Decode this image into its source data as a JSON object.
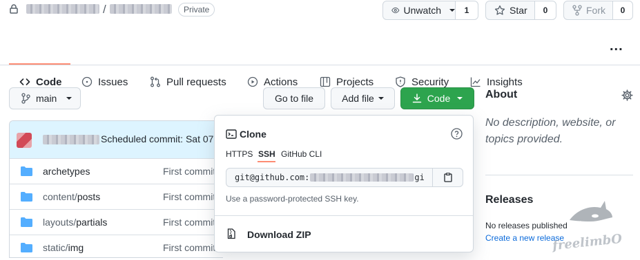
{
  "repo": {
    "visibility": "Private"
  },
  "header": {
    "unwatch_label": "Unwatch",
    "unwatch_count": "1",
    "star_label": "Star",
    "star_count": "0",
    "fork_label": "Fork",
    "fork_count": "0"
  },
  "nav": {
    "tabs": [
      {
        "label": "Code",
        "icon": "code-icon"
      },
      {
        "label": "Issues",
        "icon": "issue-icon"
      },
      {
        "label": "Pull requests",
        "icon": "pull-request-icon"
      },
      {
        "label": "Actions",
        "icon": "play-icon"
      },
      {
        "label": "Projects",
        "icon": "table-icon"
      },
      {
        "label": "Security",
        "icon": "shield-icon"
      },
      {
        "label": "Insights",
        "icon": "graph-icon"
      }
    ],
    "more": "..."
  },
  "toolbar": {
    "branch": "main",
    "go_to_file": "Go to file",
    "add_file": "Add file",
    "code": "Code"
  },
  "commit": {
    "message": "Scheduled commit: Sat 07"
  },
  "files": [
    {
      "dir": "",
      "name": "archetypes",
      "message": "First commit"
    },
    {
      "dir": "content/",
      "name": "posts",
      "message": "First commit"
    },
    {
      "dir": "layouts/",
      "name": "partials",
      "message": "First commit"
    },
    {
      "dir": "static/",
      "name": "img",
      "message": "First commit"
    }
  ],
  "clone": {
    "title": "Clone",
    "tabs": [
      "HTTPS",
      "SSH",
      "GitHub CLI"
    ],
    "active_tab": "SSH",
    "url_prefix": "git@github.com:",
    "url_suffix": "gi",
    "hint": "Use a password-protected SSH key.",
    "download_zip": "Download ZIP"
  },
  "about": {
    "title": "About",
    "description": "No description, website, or topics provided."
  },
  "releases": {
    "title": "Releases",
    "none": "No releases published",
    "create_link": "Create a new release"
  },
  "watermark": {
    "text": "freelimbO"
  },
  "colors": {
    "accent": "#fd8c73",
    "green": "#2da44e",
    "link": "#0969da"
  }
}
